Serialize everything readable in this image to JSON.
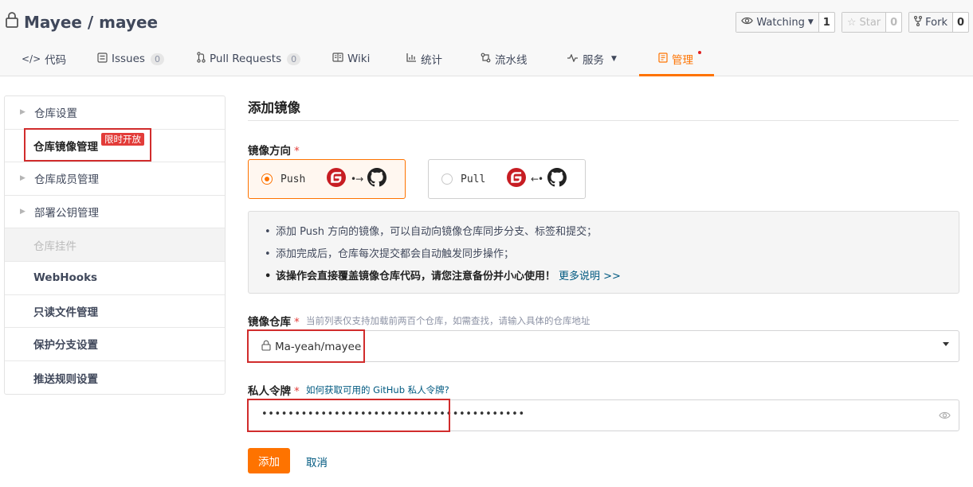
{
  "repo": {
    "title": "Mayee / mayee",
    "watching_label": "Watching",
    "watching_count": "1",
    "star_label": "Star",
    "star_count": "0",
    "fork_label": "Fork",
    "fork_count": "0"
  },
  "tabs": [
    {
      "label": "代码",
      "icon": "code-icon"
    },
    {
      "label": "Issues",
      "badge": "0",
      "icon": "issues-icon"
    },
    {
      "label": "Pull Requests",
      "badge": "0",
      "icon": "pull-request-icon"
    },
    {
      "label": "Wiki",
      "icon": "wiki-icon"
    },
    {
      "label": "统计",
      "icon": "chart-icon"
    },
    {
      "label": "流水线",
      "icon": "pipeline-icon"
    },
    {
      "label": "服务",
      "icon": "pulse-icon"
    },
    {
      "label": "管理",
      "icon": "manage-icon",
      "active": true
    }
  ],
  "sidebar": {
    "items": [
      {
        "label": "仓库设置"
      },
      {
        "label": "仓库镜像管理",
        "badge": "限时开放"
      },
      {
        "label": "仓库成员管理"
      },
      {
        "label": "部署公钥管理"
      },
      {
        "label": "仓库挂件"
      },
      {
        "label": "WebHooks"
      },
      {
        "label": "只读文件管理"
      },
      {
        "label": "保护分支设置"
      },
      {
        "label": "推送规则设置"
      }
    ]
  },
  "form": {
    "title": "添加镜像",
    "direction_label": "镜像方向",
    "push_label": "Push",
    "pull_label": "Pull",
    "notices": [
      "添加 Push 方向的镜像，可以自动向镜像仓库同步分支、标签和提交；",
      "添加完成后，仓库每次提交都会自动触发同步操作；",
      "该操作会直接覆盖镜像仓库代码，请您注意备份并小心使用！"
    ],
    "more_link": "更多说明 >>",
    "repo_label": "镜像仓库",
    "repo_hint": "当前列表仅支持加载前两百个仓库，如需查找，请输入具体的仓库地址",
    "repo_value": "Ma-yeah/mayee",
    "token_label": "私人令牌",
    "token_hint": "如何获取可用的 GitHub 私人令牌?",
    "token_value": "••••••••••••••••••••••••••••••••••••••••",
    "add_button": "添加",
    "cancel_button": "取消"
  },
  "colors": {
    "accent": "#fe7300",
    "link": "#005980",
    "required": "#e23c39",
    "highlight_box": "#d12c2c"
  }
}
